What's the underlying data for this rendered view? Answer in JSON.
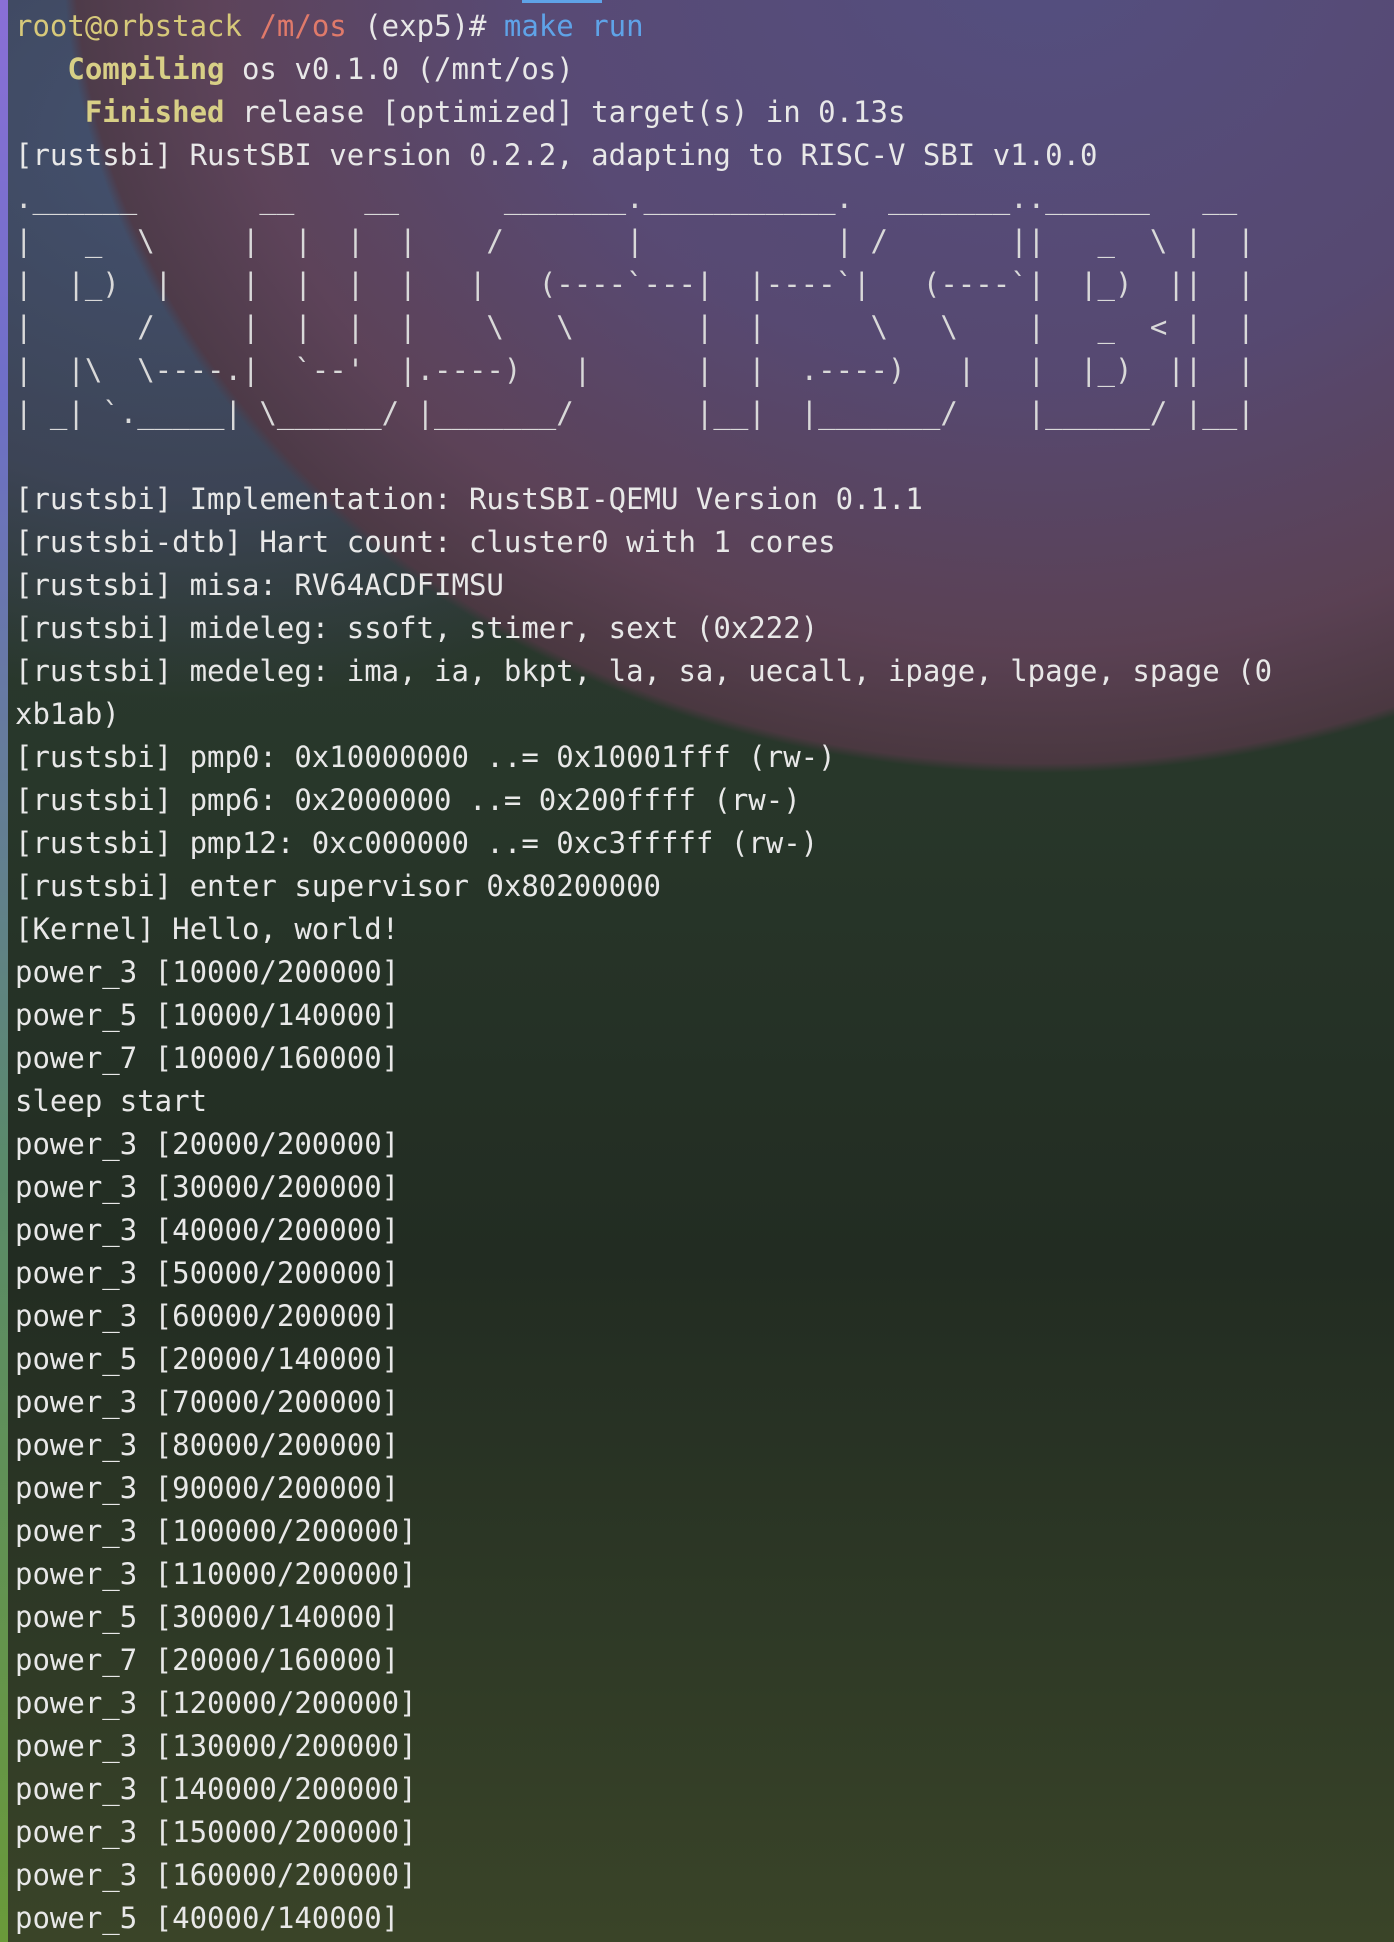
{
  "prompt": {
    "user_host": "root@orbstack",
    "path": "/m/os",
    "branch": " (exp5)# ",
    "command_1": "make",
    "command_2": " run"
  },
  "build": [
    {
      "status": "   Compiling",
      "text": " os v0.1.0 (/mnt/os)"
    },
    {
      "status": "    Finished",
      "text": " release [optimized] target(s) in 0.13s"
    }
  ],
  "rustsbi_version": "[rustsbi] RustSBI version 0.2.2, adapting to RISC-V SBI v1.0.0",
  "ascii_art": [
    ".______       __    __      _______.___________.  _______..______   __",
    "|   _  \\     |  |  |  |    /       |           | /       ||   _  \\ |  |",
    "|  |_)  |    |  |  |  |   |   (----`---|  |----`|   (----`|  |_)  ||  |",
    "|      /     |  |  |  |    \\   \\       |  |      \\   \\    |   _  < |  |",
    "|  |\\  \\----.|  `--'  |.----)   |      |  |  .----)   |   |  |_)  ||  |",
    "| _| `._____| \\______/ |_______/       |__|  |_______/    |______/ |__|"
  ],
  "log_lines": [
    "[rustsbi] Implementation: RustSBI-QEMU Version 0.1.1",
    "[rustsbi-dtb] Hart count: cluster0 with 1 cores",
    "[rustsbi] misa: RV64ACDFIMSU",
    "[rustsbi] mideleg: ssoft, stimer, sext (0x222)",
    "[rustsbi] medeleg: ima, ia, bkpt, la, sa, uecall, ipage, lpage, spage (0",
    "xb1ab)",
    "[rustsbi] pmp0: 0x10000000 ..= 0x10001fff (rw-)",
    "[rustsbi] pmp6: 0x2000000 ..= 0x200ffff (rw-)",
    "[rustsbi] pmp12: 0xc000000 ..= 0xc3fffff (rw-)",
    "[rustsbi] enter supervisor 0x80200000",
    "[Kernel] Hello, world!",
    "power_3 [10000/200000]",
    "power_5 [10000/140000]",
    "power_7 [10000/160000]",
    "sleep start",
    "power_3 [20000/200000]",
    "power_3 [30000/200000]",
    "power_3 [40000/200000]",
    "power_3 [50000/200000]",
    "power_3 [60000/200000]",
    "power_5 [20000/140000]",
    "power_3 [70000/200000]",
    "power_3 [80000/200000]",
    "power_3 [90000/200000]",
    "power_3 [100000/200000]",
    "power_3 [110000/200000]",
    "power_5 [30000/140000]",
    "power_7 [20000/160000]",
    "power_3 [120000/200000]",
    "power_3 [130000/200000]",
    "power_3 [140000/200000]",
    "power_3 [150000/200000]",
    "power_3 [160000/200000]",
    "power_5 [40000/140000]"
  ]
}
